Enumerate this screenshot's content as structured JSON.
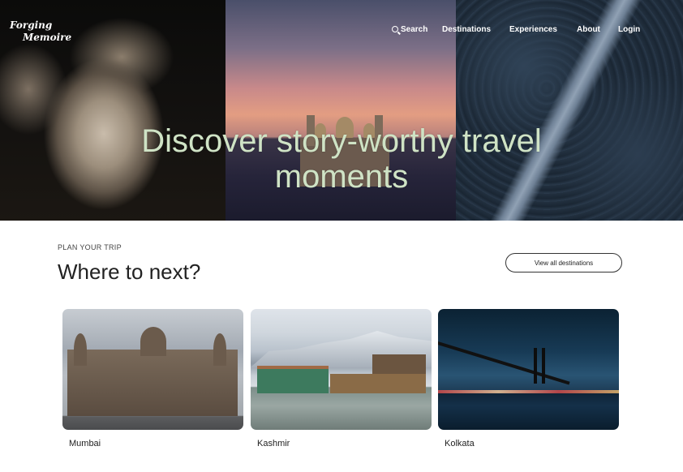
{
  "brand": {
    "line1": "Forging",
    "line2": "Memoire"
  },
  "nav": {
    "search": "Search",
    "destinations": "Destinations",
    "experiences": "Experiences",
    "about": "About",
    "login": "Login"
  },
  "hero": {
    "title_line1": "Discover story-worthy travel",
    "title_line2": "moments"
  },
  "section": {
    "kicker": "PLAN YOUR TRIP",
    "heading": "Where to next?",
    "view_all": "View all destinations"
  },
  "destinations": [
    {
      "name": "Mumbai"
    },
    {
      "name": "Kashmir"
    },
    {
      "name": "Kolkata"
    }
  ]
}
